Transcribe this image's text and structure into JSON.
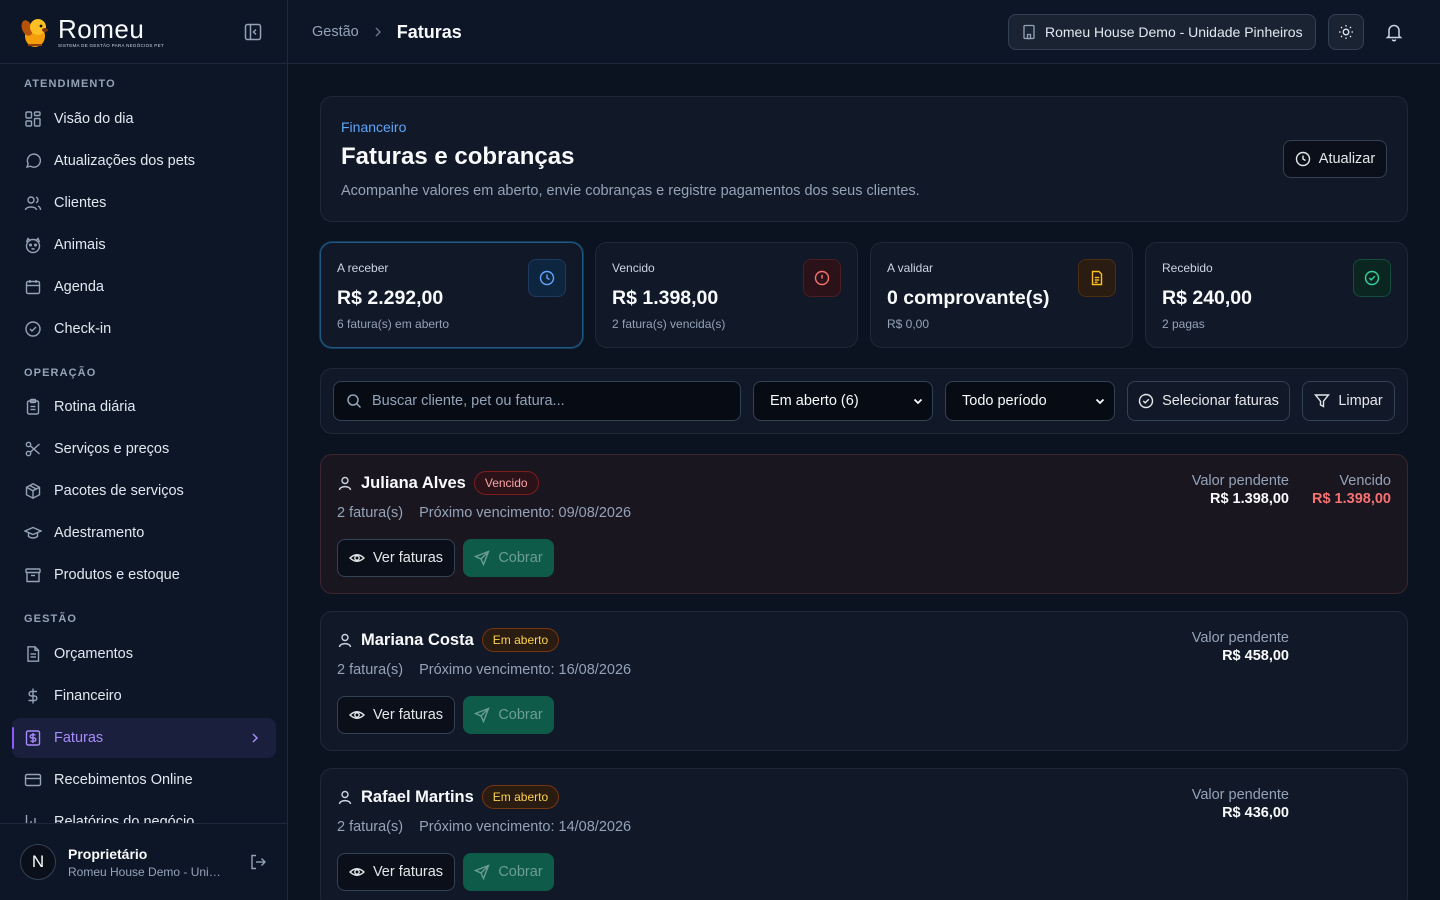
{
  "brand": {
    "name": "Romeu",
    "tagline": "SISTEMA DE GESTÃO PARA NEGÓCIOS PET"
  },
  "sidebar": {
    "sections": [
      {
        "title": "ATENDIMENTO",
        "items": [
          {
            "label": "Visão do dia",
            "icon": "grid-icon"
          },
          {
            "label": "Atualizações dos pets",
            "icon": "chat-icon"
          },
          {
            "label": "Clientes",
            "icon": "users-icon"
          },
          {
            "label": "Animais",
            "icon": "paw-icon"
          },
          {
            "label": "Agenda",
            "icon": "calendar-icon"
          },
          {
            "label": "Check-in",
            "icon": "check-circle-icon"
          }
        ]
      },
      {
        "title": "OPERAÇÃO",
        "items": [
          {
            "label": "Rotina diária",
            "icon": "clipboard-icon"
          },
          {
            "label": "Serviços e preços",
            "icon": "scissors-icon"
          },
          {
            "label": "Pacotes de serviços",
            "icon": "package-icon"
          },
          {
            "label": "Adestramento",
            "icon": "graduation-cap-icon"
          },
          {
            "label": "Produtos e estoque",
            "icon": "archive-icon"
          }
        ]
      },
      {
        "title": "GESTÃO",
        "items": [
          {
            "label": "Orçamentos",
            "icon": "file-text-icon"
          },
          {
            "label": "Financeiro",
            "icon": "dollar-icon"
          },
          {
            "label": "Faturas",
            "icon": "invoice-icon",
            "active": true
          },
          {
            "label": "Recebimentos Online",
            "icon": "credit-card-icon"
          },
          {
            "label": "Relatórios do negócio",
            "icon": "bar-chart-icon"
          }
        ]
      }
    ],
    "user": {
      "initial": "N",
      "name": "Proprietário",
      "unit": "Romeu House Demo - Unidade Pinheiros"
    }
  },
  "topbar": {
    "breadcrumb_parent": "Gestão",
    "breadcrumb_current": "Faturas",
    "unit_selector": "Romeu House Demo - Unidade Pinheiros"
  },
  "header": {
    "eyebrow": "Financeiro",
    "title": "Faturas e cobranças",
    "subtitle": "Acompanhe valores em aberto, envie cobranças e registre pagamentos dos seus clientes.",
    "refresh_label": "Atualizar"
  },
  "stats": [
    {
      "label": "A receber",
      "value": "R$ 2.292,00",
      "sub": "6 fatura(s) em aberto",
      "icon": "clock-icon",
      "color": "#60a5fa"
    },
    {
      "label": "Vencido",
      "value": "R$ 1.398,00",
      "sub": "2 fatura(s) vencida(s)",
      "icon": "alert-circle-icon",
      "color": "#f87171"
    },
    {
      "label": "A validar",
      "value": "0 comprovante(s)",
      "sub": "R$ 0,00",
      "icon": "file-icon",
      "color": "#fbbf24"
    },
    {
      "label": "Recebido",
      "value": "R$ 240,00",
      "sub": "2 pagas",
      "icon": "check-circle-icon",
      "color": "#34d399"
    }
  ],
  "filters": {
    "search_placeholder": "Buscar cliente, pet ou fatura...",
    "status_value": "Em aberto (6)",
    "period_value": "Todo período",
    "select_invoices_label": "Selecionar faturas",
    "clear_label": "Limpar"
  },
  "clients": [
    {
      "name": "Juliana Alves",
      "badge": "Vencido",
      "badge_kind": "red",
      "count": "2 fatura(s)",
      "next_due": "Próximo vencimento: 09/08/2026",
      "pending_label": "Valor pendente",
      "pending_value": "R$ 1.398,00",
      "overdue_label": "Vencido",
      "overdue_value": "R$ 1.398,00"
    },
    {
      "name": "Mariana Costa",
      "badge": "Em aberto",
      "badge_kind": "amber",
      "count": "2 fatura(s)",
      "next_due": "Próximo vencimento: 16/08/2026",
      "pending_label": "Valor pendente",
      "pending_value": "R$ 458,00"
    },
    {
      "name": "Rafael Martins",
      "badge": "Em aberto",
      "badge_kind": "amber",
      "count": "2 fatura(s)",
      "next_due": "Próximo vencimento: 14/08/2026",
      "pending_label": "Valor pendente",
      "pending_value": "R$ 436,00"
    }
  ],
  "actions": {
    "view_label": "Ver faturas",
    "charge_label": "Cobrar"
  }
}
